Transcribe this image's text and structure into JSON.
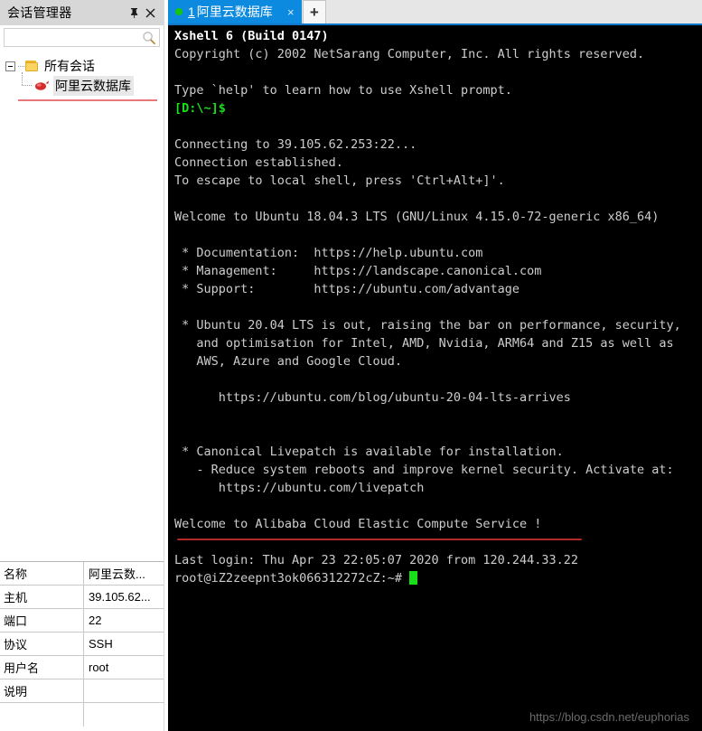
{
  "session_manager": {
    "title": "会话管理器",
    "pin_icon": "pin-icon",
    "close_icon": "close-icon",
    "search": {
      "value": "",
      "placeholder": "",
      "icon": "search-icon"
    },
    "tree": {
      "root": {
        "label": "所有会话",
        "icon": "folder-icon",
        "expanded": true
      },
      "children": [
        {
          "label": "阿里云数据库",
          "icon": "session-icon",
          "selected": true
        }
      ]
    },
    "properties": [
      {
        "key": "名称",
        "value": "阿里云数..."
      },
      {
        "key": "主机",
        "value": "39.105.62..."
      },
      {
        "key": "端口",
        "value": "22"
      },
      {
        "key": "协议",
        "value": "SSH"
      },
      {
        "key": "用户名",
        "value": "root"
      },
      {
        "key": "说明",
        "value": ""
      },
      {
        "key": "",
        "value": ""
      }
    ]
  },
  "tabbar": {
    "tabs": [
      {
        "index": "1",
        "title": "阿里云数据库",
        "status_dot": "connected",
        "close_label": "×",
        "active": true
      }
    ],
    "new_tab_label": "+"
  },
  "terminal": {
    "lines": [
      {
        "text": "Xshell 6 (Build 0147)",
        "style": "bold-white"
      },
      {
        "text": "Copyright (c) 2002 NetSarang Computer, Inc. All rights reserved.",
        "style": "normal"
      },
      {
        "text": "",
        "style": "normal"
      },
      {
        "text": "Type `help' to learn how to use Xshell prompt.",
        "style": "normal"
      },
      {
        "text": "[D:\\~]$",
        "style": "green"
      },
      {
        "text": "",
        "style": "normal"
      },
      {
        "text": "Connecting to 39.105.62.253:22...",
        "style": "normal"
      },
      {
        "text": "Connection established.",
        "style": "normal"
      },
      {
        "text": "To escape to local shell, press 'Ctrl+Alt+]'.",
        "style": "normal"
      },
      {
        "text": "",
        "style": "normal"
      },
      {
        "text": "Welcome to Ubuntu 18.04.3 LTS (GNU/Linux 4.15.0-72-generic x86_64)",
        "style": "normal"
      },
      {
        "text": "",
        "style": "normal"
      },
      {
        "text": " * Documentation:  https://help.ubuntu.com",
        "style": "normal"
      },
      {
        "text": " * Management:     https://landscape.canonical.com",
        "style": "normal"
      },
      {
        "text": " * Support:        https://ubuntu.com/advantage",
        "style": "normal"
      },
      {
        "text": "",
        "style": "normal"
      },
      {
        "text": " * Ubuntu 20.04 LTS is out, raising the bar on performance, security,",
        "style": "normal"
      },
      {
        "text": "   and optimisation for Intel, AMD, Nvidia, ARM64 and Z15 as well as",
        "style": "normal"
      },
      {
        "text": "   AWS, Azure and Google Cloud.",
        "style": "normal"
      },
      {
        "text": "",
        "style": "normal"
      },
      {
        "text": "      https://ubuntu.com/blog/ubuntu-20-04-lts-arrives",
        "style": "normal"
      },
      {
        "text": "",
        "style": "normal"
      },
      {
        "text": "",
        "style": "normal"
      },
      {
        "text": " * Canonical Livepatch is available for installation.",
        "style": "normal"
      },
      {
        "text": "   - Reduce system reboots and improve kernel security. Activate at:",
        "style": "normal"
      },
      {
        "text": "      https://ubuntu.com/livepatch",
        "style": "normal"
      },
      {
        "text": "",
        "style": "normal"
      },
      {
        "text": "Welcome to Alibaba Cloud Elastic Compute Service !",
        "style": "normal"
      },
      {
        "text": "",
        "style": "normal"
      },
      {
        "text": "Last login: Thu Apr 23 22:05:07 2020 from 120.244.33.22",
        "style": "normal"
      }
    ],
    "prompt": "root@iZ2zeepnt3ok066312272cZ:~#",
    "watermark": "https://blog.csdn.net/euphorias"
  },
  "colors": {
    "tab_active": "#0b8ae0",
    "terminal_bg": "#000000",
    "terminal_fg": "#cdcdcd",
    "prompt_green": "#18e018",
    "annotation_red": "#b02a28",
    "tree_underline": "#e8797b"
  }
}
